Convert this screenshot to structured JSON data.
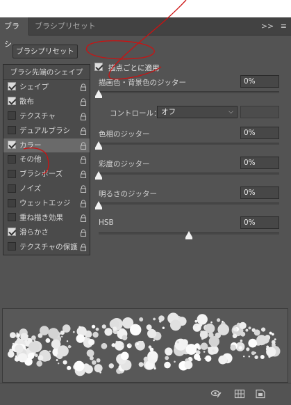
{
  "tabs": [
    {
      "label": "ブラシ",
      "active": true
    },
    {
      "label": "ブラシプリセット",
      "active": false
    }
  ],
  "panel_menu": {
    "expand": ">>",
    "menu": "≡"
  },
  "preset_button": "ブラシプリセット",
  "left_list": {
    "header": "ブラシ先端のシェイプ",
    "items": [
      {
        "label": "シェイプ",
        "checked": true,
        "selected": false
      },
      {
        "label": "散布",
        "checked": true,
        "selected": false
      },
      {
        "label": "テクスチャ",
        "checked": false,
        "selected": false
      },
      {
        "label": "デュアルブラシ",
        "checked": false,
        "selected": false
      },
      {
        "label": "カラー",
        "checked": true,
        "selected": true
      },
      {
        "label": "その他",
        "checked": false,
        "selected": false
      },
      {
        "label": "ブラシポーズ",
        "checked": false,
        "selected": false
      },
      {
        "label": "ノイズ",
        "checked": false,
        "selected": false
      },
      {
        "label": "ウェットエッジ",
        "checked": false,
        "selected": false
      },
      {
        "label": "重ね描き効果",
        "checked": false,
        "selected": false
      },
      {
        "label": "滑らかさ",
        "checked": true,
        "selected": false
      },
      {
        "label": "テクスチャの保護",
        "checked": false,
        "selected": false
      }
    ]
  },
  "main": {
    "apply_per_tip": {
      "label": "描点ごとに適用",
      "checked": true
    },
    "fg_bg_jitter": {
      "label": "描画色・背景色のジッター",
      "value": "0%",
      "level": 0
    },
    "control": {
      "label": "コントロール：",
      "value": "オフ"
    },
    "hue_jitter": {
      "label": "色相のジッター",
      "value": "0%",
      "level": 0
    },
    "saturation_jitter": {
      "label": "彩度のジッター",
      "value": "0%",
      "level": 0
    },
    "brightness_jitter": {
      "label": "明るさのジッター",
      "value": "0%",
      "level": 0
    },
    "hsb": {
      "label": "HSB",
      "value": "0%",
      "level": 0.5
    }
  },
  "icons": {
    "lock": "lock-icon",
    "bottom": [
      "eye-brush-icon",
      "grid-icon",
      "new-preset-icon"
    ]
  },
  "colors": {
    "panel_bg": "#535353",
    "annotation": "#cc1111"
  }
}
